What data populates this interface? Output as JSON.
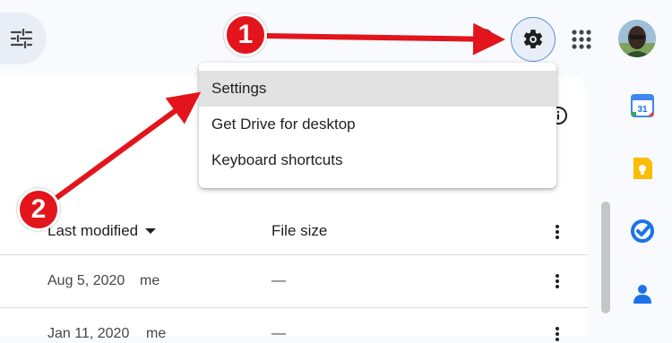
{
  "colors": {
    "accent": "#0b57d0",
    "annotation": "#e3141b",
    "menu_hover": "#e2e2e2"
  },
  "header": {
    "icons": [
      "filter-icon",
      "help-icon",
      "settings-gear-icon",
      "apps-grid-icon",
      "avatar"
    ]
  },
  "menu": {
    "items": [
      {
        "label": "Settings",
        "highlighted": true
      },
      {
        "label": "Get Drive for desktop"
      },
      {
        "label": "Keyboard shortcuts"
      }
    ]
  },
  "table": {
    "columns": [
      {
        "label": "Last modified",
        "sort": "descending"
      },
      {
        "label": "File size"
      }
    ],
    "rows": [
      {
        "modified": "Aug 5, 2020",
        "owner": "me",
        "size": "—"
      },
      {
        "modified": "Jan 11, 2020",
        "owner": "me",
        "size": "—"
      }
    ]
  },
  "side_panel": {
    "icons": [
      "calendar-icon",
      "keep-icon",
      "tasks-icon",
      "contacts-icon"
    ],
    "calendar_day": "31"
  },
  "annotations": [
    {
      "number": "1",
      "target": "settings-gear-icon"
    },
    {
      "number": "2",
      "target": "menu-item-settings"
    }
  ]
}
